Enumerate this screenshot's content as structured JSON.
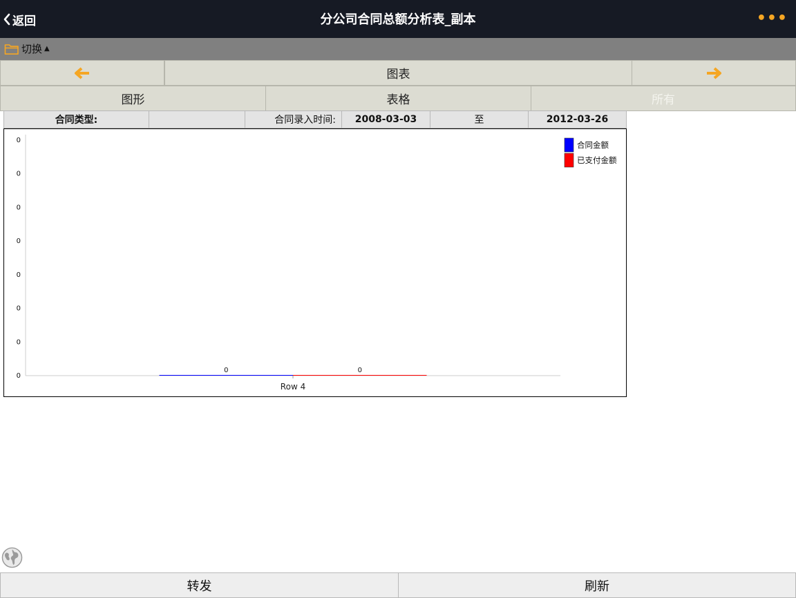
{
  "header": {
    "back_label": "返回",
    "title": "分公司合同总额分析表_副本",
    "more_icon": "more-icon"
  },
  "switchbar": {
    "label": "切换",
    "folder_icon": "folder-icon"
  },
  "nav": {
    "center_label": "图表",
    "prev_icon": "arrow-left-icon",
    "next_icon": "arrow-right-icon"
  },
  "view_tabs": [
    {
      "label": "图形"
    },
    {
      "label": "表格"
    },
    {
      "label": "所有"
    }
  ],
  "filter": {
    "type_label": "合同类型:",
    "type_value": "",
    "time_label": "合同录入时间:",
    "date_from": "2008-03-03",
    "to_label": "至",
    "date_to": "2012-03-26"
  },
  "chart_data": {
    "type": "bar",
    "categories": [
      "Row 4"
    ],
    "series": [
      {
        "name": "合同金额",
        "values": [
          0
        ],
        "color": "#0000ff"
      },
      {
        "name": "已支付金额",
        "values": [
          0
        ],
        "color": "#ff0000"
      }
    ],
    "y_tick_labels": [
      "0",
      "0",
      "0",
      "0",
      "0",
      "0",
      "0",
      "0"
    ],
    "legend_position": "top-right",
    "grid": false
  },
  "footer": {
    "forward_label": "转发",
    "refresh_label": "刷新"
  },
  "colors": {
    "accent": "#f5a623",
    "topbar": "#161a24"
  }
}
